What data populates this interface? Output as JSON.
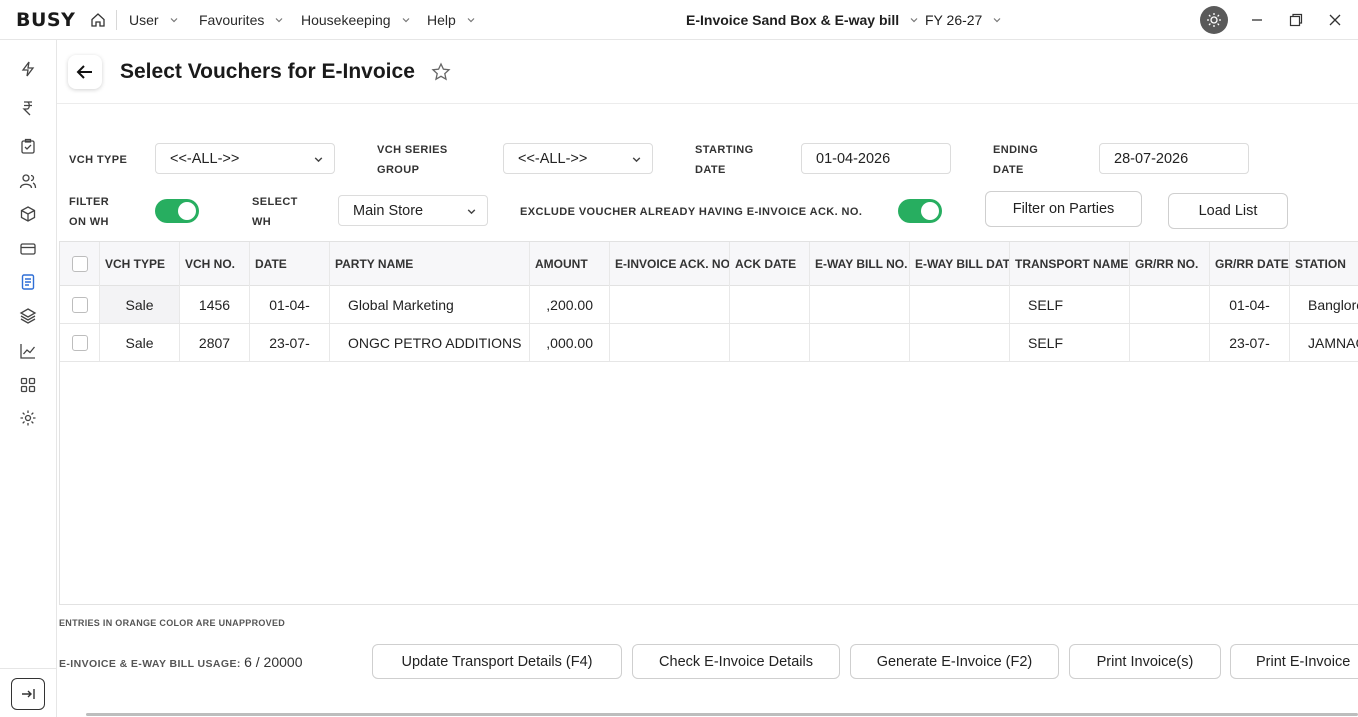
{
  "app": {
    "logo": "BUSY"
  },
  "menu": [
    {
      "label": "User"
    },
    {
      "label": "Favourites"
    },
    {
      "label": "Housekeeping"
    },
    {
      "label": "Help"
    }
  ],
  "company": "E-Invoice Sand Box & E-way bill",
  "fy": "FY 26-27",
  "page": {
    "title": "Select Vouchers for E-Invoice"
  },
  "filters": {
    "vch_type_label": "VCH TYPE",
    "vch_type_value": "<<-ALL->>",
    "vch_series_label_1": "VCH SERIES",
    "vch_series_label_2": "GROUP",
    "vch_series_value": "<<-ALL->>",
    "start_label_1": "STARTING",
    "start_label_2": "DATE",
    "start_value": "01-04-2026",
    "end_label_1": "ENDING",
    "end_label_2": "DATE",
    "end_value": "28-07-2026",
    "filter_wh_label_1": "FILTER",
    "filter_wh_label_2": "ON WH",
    "select_wh_label_1": "SELECT",
    "select_wh_label_2": "WH",
    "select_wh_value": "Main Store",
    "exclude_label": "EXCLUDE VOUCHER ALREADY HAVING E-INVOICE ACK. NO.",
    "filter_parties_btn": "Filter on Parties",
    "load_list_btn": "Load List"
  },
  "table": {
    "headers": [
      "VCH TYPE",
      "VCH NO.",
      "DATE",
      "PARTY NAME",
      "AMOUNT",
      "E-INVOICE ACK. NO.",
      "ACK DATE",
      "E-WAY BILL NO.",
      "E-WAY BILL DAT",
      "TRANSPORT NAME",
      "GR/RR NO.",
      "GR/RR DATE",
      "STATION"
    ],
    "rows": [
      {
        "vch_type": "Sale",
        "vch_no": "1456",
        "date": "01-04-",
        "party": "Global Marketing",
        "amount": ",200.00",
        "ack_no": "",
        "ack_date": "",
        "eway_no": "",
        "eway_date": "",
        "transport": "SELF",
        "grrr_no": "",
        "grrr_date": "01-04-",
        "station": "Banglore"
      },
      {
        "vch_type": "Sale",
        "vch_no": "2807",
        "date": "23-07-",
        "party": "ONGC PETRO ADDITIONS",
        "amount": ",000.00",
        "ack_no": "",
        "ack_date": "",
        "eway_no": "",
        "eway_date": "",
        "transport": "SELF",
        "grrr_no": "",
        "grrr_date": "23-07-",
        "station": "JAMNAGAR"
      }
    ]
  },
  "footer": {
    "note": "ENTRIES IN ORANGE COLOR ARE UNAPPROVED",
    "usage_label": "E-INVOICE & E-WAY BILL USAGE:",
    "usage_value": "6 / 20000",
    "buttons": [
      "Update Transport Details (F4)",
      "Check E-Invoice Details",
      "Generate E-Invoice (F2)",
      "Print Invoice(s)",
      "Print E-Invoice"
    ]
  },
  "colors": {
    "toggle_on": "#27ae60",
    "theme_button": "#5a5a5a"
  },
  "icons": [
    "home-icon",
    "chevron-down-icon",
    "sun-icon",
    "minimize-icon",
    "restore-icon",
    "close-icon",
    "back-arrow-icon",
    "star-icon",
    "lightning-icon",
    "rupee-icon",
    "clipboard-icon",
    "users-icon",
    "box-icon",
    "card-icon",
    "document-icon",
    "layers-icon",
    "chart-icon",
    "grid-icon",
    "gear-icon",
    "expand-sidebar-icon"
  ]
}
